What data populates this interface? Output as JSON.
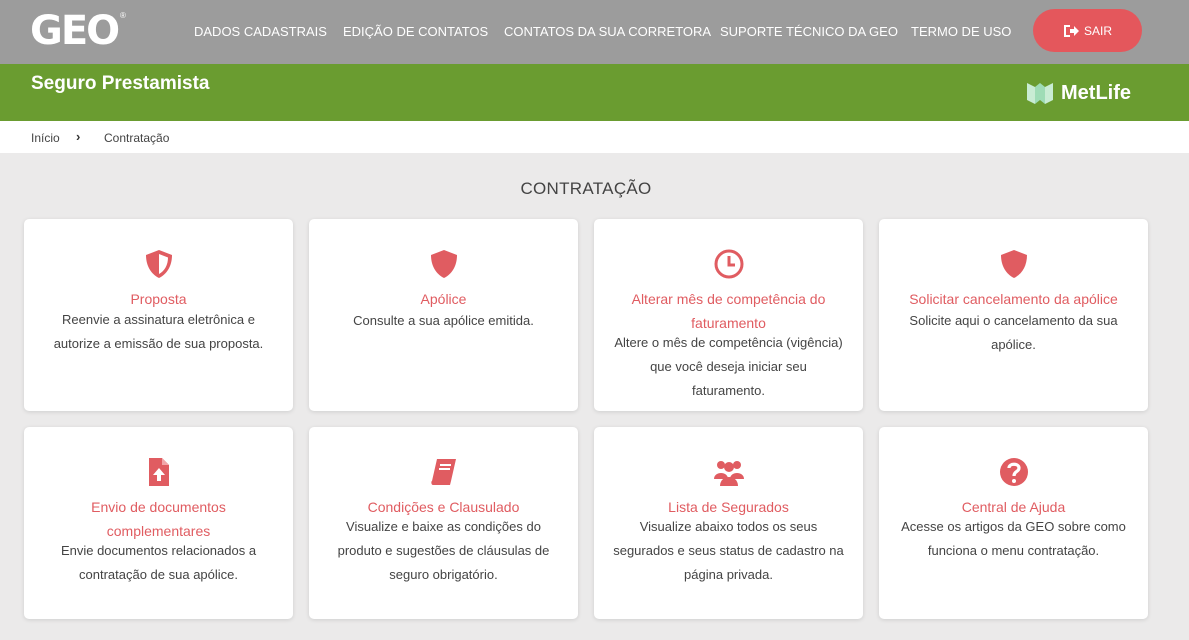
{
  "logo": {
    "text": "GEO",
    "reg": "®"
  },
  "nav": {
    "items": [
      {
        "label": "DADOS CADASTRAIS"
      },
      {
        "label": "EDIÇÃO DE CONTATOS"
      },
      {
        "label": "CONTATOS DA SUA CORRETORA"
      },
      {
        "label": "SUPORTE TÉCNICO DA GEO"
      },
      {
        "label": "TERMO DE USO"
      }
    ],
    "logout_label": "SAIR"
  },
  "banner": {
    "title": "Seguro Prestamista",
    "partner_logo_text": "MetLife"
  },
  "breadcrumb": {
    "home": "Início",
    "current": "Contratação"
  },
  "page_title": "CONTRATAÇÃO",
  "colors": {
    "accent": "#e05c61",
    "topbar": "#9c9c9c",
    "banner": "#6a9c30",
    "button": "#e4575c"
  },
  "cards": [
    {
      "icon": "shield-half-icon",
      "title": "Proposta",
      "description": "Reenvie a assinatura eletrônica e autorize a emissão de sua proposta."
    },
    {
      "icon": "shield-icon",
      "title": "Apólice",
      "description": "Consulte a sua apólice emitida."
    },
    {
      "icon": "clock-icon",
      "title": "Alterar mês de competência do faturamento",
      "description": "Altere o mês de competência (vigência) que você deseja iniciar seu faturamento."
    },
    {
      "icon": "shield-icon",
      "title": "Solicitar cancelamento da apólice",
      "description": "Solicite aqui o cancelamento da sua apólice."
    },
    {
      "icon": "file-upload-icon",
      "title": "Envio de documentos complementares",
      "description": "Envie documentos relacionados a contratação de sua apólice."
    },
    {
      "icon": "book-icon",
      "title": "Condições e Clausulado",
      "description": "Visualize e baixe as condições do produto e sugestões de cláusulas de seguro obrigatório."
    },
    {
      "icon": "users-icon",
      "title": "Lista de Segurados",
      "description": "Visualize abaixo todos os seus segurados e seus status de cadastro na página privada."
    },
    {
      "icon": "question-circle-icon",
      "title": "Central de Ajuda",
      "description": "Acesse os artigos da GEO sobre como funciona o menu contratação."
    }
  ]
}
